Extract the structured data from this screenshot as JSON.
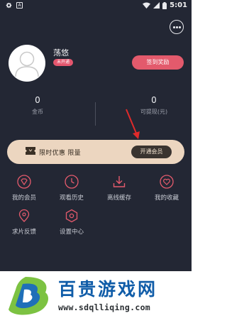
{
  "status_bar": {
    "left_icons": [
      "settings-icon",
      "a-icon"
    ],
    "right_icons": [
      "wifi-icon",
      "signal-icon",
      "battery-icon"
    ],
    "time": "5:01"
  },
  "profile": {
    "username": "荡悠",
    "vip_status": "未开通",
    "reward_button": "签到奖励"
  },
  "stats": [
    {
      "value": "0",
      "label": "金币"
    },
    {
      "value": "0",
      "label": "可提现(元)"
    }
  ],
  "promo": {
    "text": "限时优惠 限量",
    "button": "开通会员"
  },
  "menu": [
    {
      "label": "我的会员",
      "icon": "diamond-icon"
    },
    {
      "label": "观看历史",
      "icon": "clock-icon"
    },
    {
      "label": "离线缓存",
      "icon": "download-icon"
    },
    {
      "label": "我的收藏",
      "icon": "heart-icon"
    },
    {
      "label": "求片反馈",
      "icon": "location-pin-icon"
    },
    {
      "label": "设置中心",
      "icon": "settings-hexagon-icon"
    }
  ],
  "watermark": {
    "title": "百贵游戏网",
    "url": "www.sdqlliqing.com"
  },
  "colors": {
    "background": "#232734",
    "accent": "#e35a6c",
    "promo_bg": "#ecd6c0",
    "watermark_blue": "#0f5ca8"
  }
}
